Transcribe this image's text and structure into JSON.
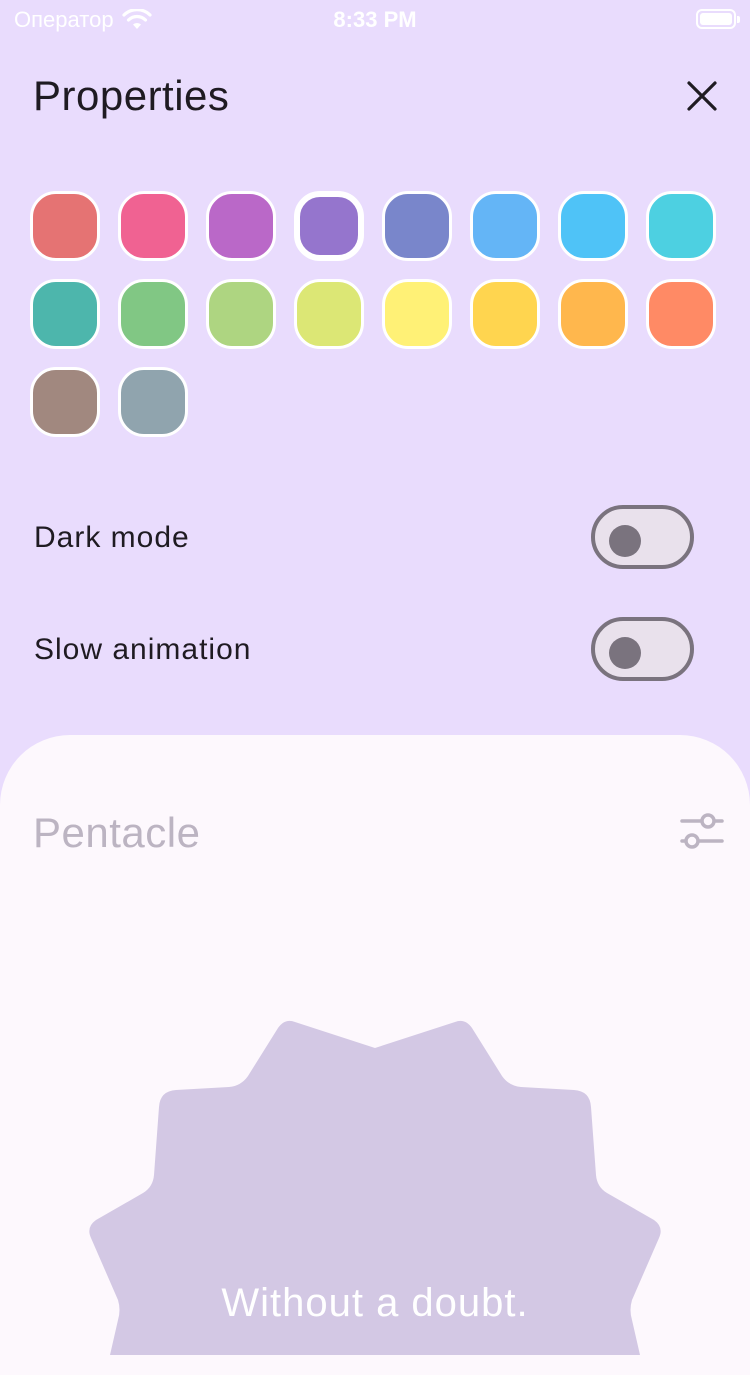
{
  "status_bar": {
    "carrier": "Оператор",
    "time": "8:33 PM"
  },
  "header": {
    "title": "Properties"
  },
  "colors": [
    "#e57373",
    "#f06292",
    "#ba68c8",
    "#9575cd",
    "#7986cb",
    "#64b5f6",
    "#4fc3f7",
    "#4dd0e1",
    "#4db6ac",
    "#81c784",
    "#aed581",
    "#dce775",
    "#fff176",
    "#ffd54f",
    "#ffb74d",
    "#ff8a65",
    "#a1887f",
    "#90a4ae"
  ],
  "selected_color": "#9575cd",
  "settings": {
    "dark_mode_label": "Dark mode",
    "dark_mode_on": false,
    "slow_animation_label": "Slow animation",
    "slow_animation_on": false
  },
  "card": {
    "title": "Pentacle",
    "answer": "Without a doubt."
  },
  "theme": {
    "background": "#e9dcfd",
    "card_background": "#fdf8fd",
    "shape_color": "#d3c8e4"
  }
}
